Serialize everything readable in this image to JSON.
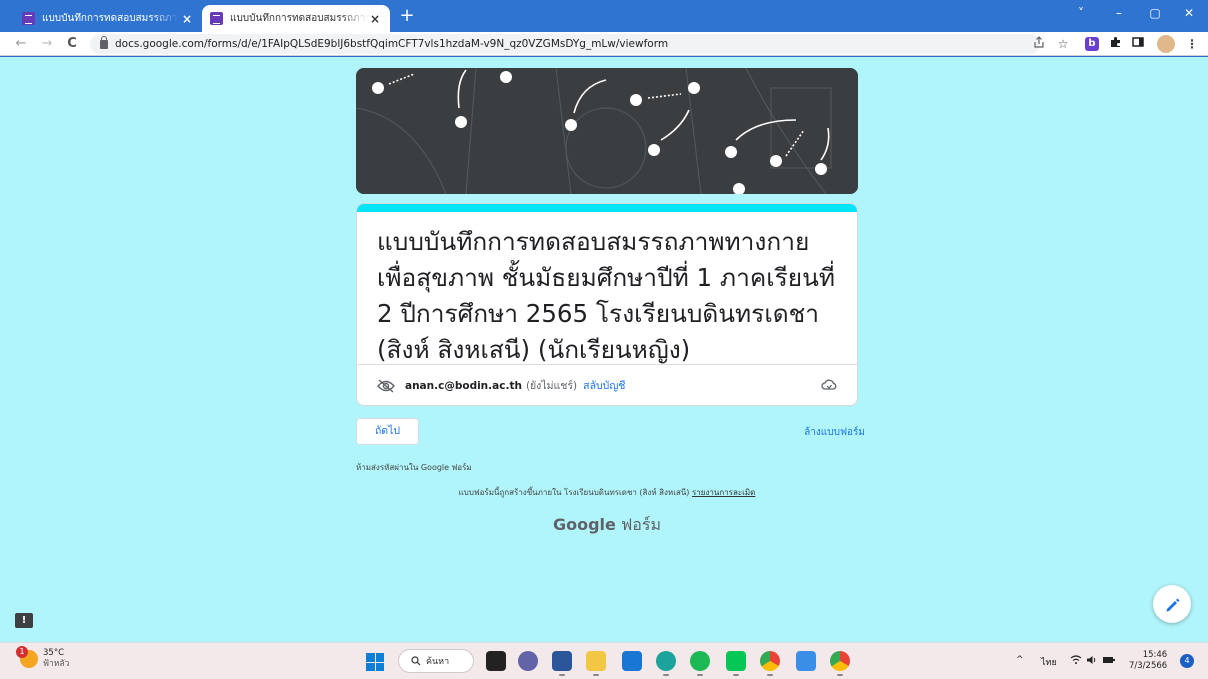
{
  "browser": {
    "tabs": [
      {
        "title": "แบบบันทึกการทดสอบสมรรถภาพทางกาย",
        "active": false
      },
      {
        "title": "แบบบันทึกการทดสอบสมรรถภาพทางกาย",
        "active": true
      }
    ],
    "close_glyph": "×",
    "new_tab_glyph": "+",
    "url": "docs.google.com/forms/d/e/1FAIpQLSdE9blJ6bstfQqimCFT7vls1hzdaM-v9N_qz0VZGMsDYg_mLw/viewform",
    "window_controls": [
      "˅",
      "–",
      "▢",
      "✕"
    ],
    "nav": {
      "back": "←",
      "forward": "→",
      "reload": "C"
    }
  },
  "form": {
    "title": "แบบบันทึกการทดสอบสมรรถภาพทางกายเพื่อสุขภาพ ชั้นมัธยมศึกษาปีที่ 1 ภาคเรียนที่ 2 ปีการศึกษา 2565 โรงเรียนบดินทรเดชา (สิงห์ สิงหเสนี) (นักเรียนหญิง)",
    "account_email": "anan.c@bodin.ac.th",
    "account_status": "(ยังไม่แชร์)",
    "switch_account": "สลับบัญชี",
    "next_button": "ถัดไป",
    "clear_form": "ล้างแบบฟอร์ม",
    "password_warning": "ห้ามส่งรหัสผ่านใน Google ฟอร์ม",
    "footer_text": "แบบฟอร์มนี้ถูกสร้างขึ้นภายใน โรงเรียนบดินทรเดชา (สิงห์ สิงหเสนี)",
    "report_link": "รายงานการละเมิด",
    "brand_google": "Google",
    "brand_forms": "ฟอร์ม",
    "theme_color": "#b0f5fb",
    "accent_color": "#00e5f8"
  },
  "taskbar": {
    "weather_badge": "1",
    "temperature": "35°C",
    "weather_desc": "ฟ้าหลัว",
    "search_label": "ค้นหา",
    "language": "ไทย",
    "time": "15:46",
    "date": "7/3/2566",
    "notification_count": "4",
    "tray_up": "^"
  }
}
